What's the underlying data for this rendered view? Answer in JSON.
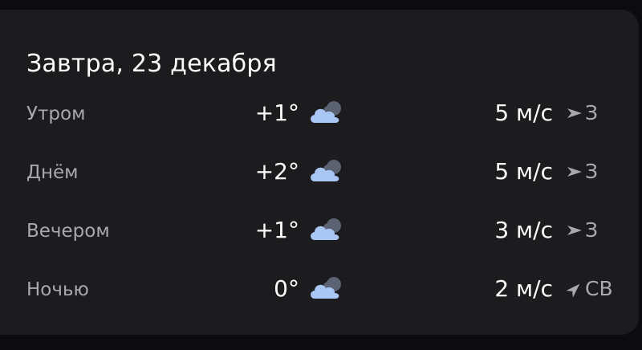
{
  "forecast": {
    "title": "Завтра, 23 декабря",
    "rows": [
      {
        "period": "Утром",
        "temp": "+1°",
        "icon": "cloud-icon",
        "speed": "5 м/с",
        "direction": "З"
      },
      {
        "period": "Днём",
        "temp": "+2°",
        "icon": "cloud-icon",
        "speed": "5 м/с",
        "direction": "З"
      },
      {
        "period": "Вечером",
        "temp": "+1°",
        "icon": "cloud-icon",
        "speed": "3 м/с",
        "direction": "З"
      },
      {
        "period": "Ночью",
        "temp": "0°",
        "icon": "cloud-icon",
        "speed": "2 м/с",
        "direction": "СВ"
      }
    ]
  },
  "colors": {
    "background": "#0c0c0e",
    "card": "#1c1c1e",
    "primary_text": "#ffffff",
    "secondary_text": "#a8a8ad",
    "cloud_front": "#a9c6f5",
    "cloud_back": "#5b6272"
  }
}
